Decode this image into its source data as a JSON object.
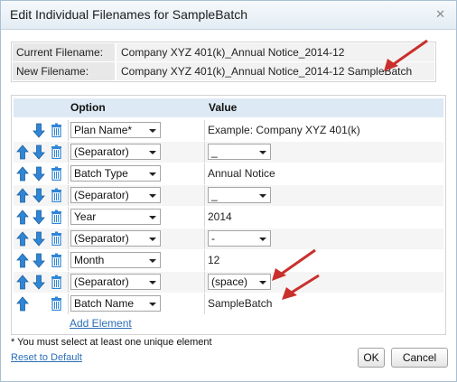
{
  "dialog": {
    "title": "Edit Individual Filenames for SampleBatch",
    "close_glyph": "✕"
  },
  "filenames": {
    "current_label": "Current Filename:",
    "current_value": "Company XYZ 401(k)_Annual Notice_2014-12",
    "new_label": "New Filename:",
    "new_value": "Company XYZ 401(k)_Annual Notice_2014-12 SampleBatch"
  },
  "grid": {
    "header_option": "Option",
    "header_value": "Value",
    "rows": [
      {
        "option": "Plan Name*",
        "value": "Example: Company XYZ 401(k)",
        "value_type": "text",
        "has_up": false,
        "has_down": true
      },
      {
        "option": "(Separator)",
        "value": "_",
        "value_type": "select",
        "has_up": true,
        "has_down": true
      },
      {
        "option": "Batch Type",
        "value": "Annual Notice",
        "value_type": "text",
        "has_up": true,
        "has_down": true
      },
      {
        "option": "(Separator)",
        "value": "_",
        "value_type": "select",
        "has_up": true,
        "has_down": true
      },
      {
        "option": "Year",
        "value": "2014",
        "value_type": "text",
        "has_up": true,
        "has_down": true
      },
      {
        "option": "(Separator)",
        "value": "-",
        "value_type": "select",
        "has_up": true,
        "has_down": true
      },
      {
        "option": "Month",
        "value": "12",
        "value_type": "text",
        "has_up": true,
        "has_down": true
      },
      {
        "option": "(Separator)",
        "value": "(space)",
        "value_type": "select",
        "has_up": true,
        "has_down": true
      },
      {
        "option": "Batch Name",
        "value": "SampleBatch",
        "value_type": "text",
        "has_up": true,
        "has_down": false
      }
    ],
    "add_element_label": "Add Element"
  },
  "footer": {
    "note": "* You must select at least one unique element",
    "reset_label": "Reset to Default",
    "ok_label": "OK",
    "cancel_label": "Cancel"
  },
  "colors": {
    "header_bg": "#dde9f4",
    "link": "#2b6fb7",
    "icon_blue": "#2f86d6",
    "annotation_arrow": "#c9302c"
  },
  "icons": {
    "move_up": "arrow-up-icon",
    "move_down": "arrow-down-icon",
    "delete": "trash-icon"
  }
}
